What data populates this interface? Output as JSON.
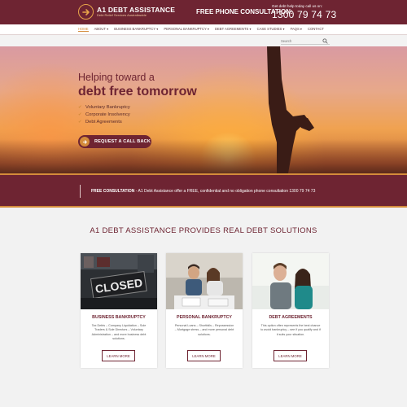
{
  "header": {
    "brand_name": "A1 DEBT ASSISTANCE",
    "brand_tagline": "Debt Relief Services Australiawide",
    "consultation_label": "FREE PHONE CONSULTATION:",
    "help_text": "Get debt help today call us on:",
    "phone": "1300 79 74 73"
  },
  "nav": {
    "items": [
      "HOME",
      "ABOUT ▾",
      "BUSINESS BANKRUPTCY ▾",
      "PERSONAL BANKRUPTCY ▾",
      "DEBT AGREEMENTS ▾",
      "CASE STUDIES ▾",
      "FAQS ▾",
      "CONTACT"
    ],
    "search_placeholder": "Search"
  },
  "hero": {
    "line1": "Helping toward a",
    "line2": "debt free tomorrow",
    "bullets": [
      "Voluntary Bankruptcy",
      "Corporate Insolvency",
      "Debt Agreements"
    ],
    "cta_label": "REQUEST A CALL BACK"
  },
  "band": {
    "label": "FREE CONSULTATION",
    "text": " - A1 Debt Assistance offer a FREE, confidential and no obligation phone consultation 1300 79 74 73"
  },
  "section": {
    "title": "A1 DEBT ASSISTANCE PROVIDES REAL DEBT SOLUTIONS"
  },
  "cards": [
    {
      "title": "BUSINESS BANKRUPTCY",
      "text": "Tax Debts – Company Liquidation – Sole Traders & Sole Directors – Voluntary Administration – and more business debt solutions.",
      "button": "LEARN MORE",
      "image_text": "CLOSED"
    },
    {
      "title": "PERSONAL BANKRUPTCY",
      "text": "Personal Loans – Shortfalls – Repossession – Mortgage stress – and more personal debt solutions.",
      "button": "LEARN MORE"
    },
    {
      "title": "DEBT AGREEMENTS",
      "text": "This option often represents the best chance to avoid bankruptcy – see if you qualify and if it suits your situation.",
      "button": "LEARN MORE"
    }
  ],
  "colors": {
    "brand": "#6e2432",
    "accent": "#d48b3a"
  }
}
